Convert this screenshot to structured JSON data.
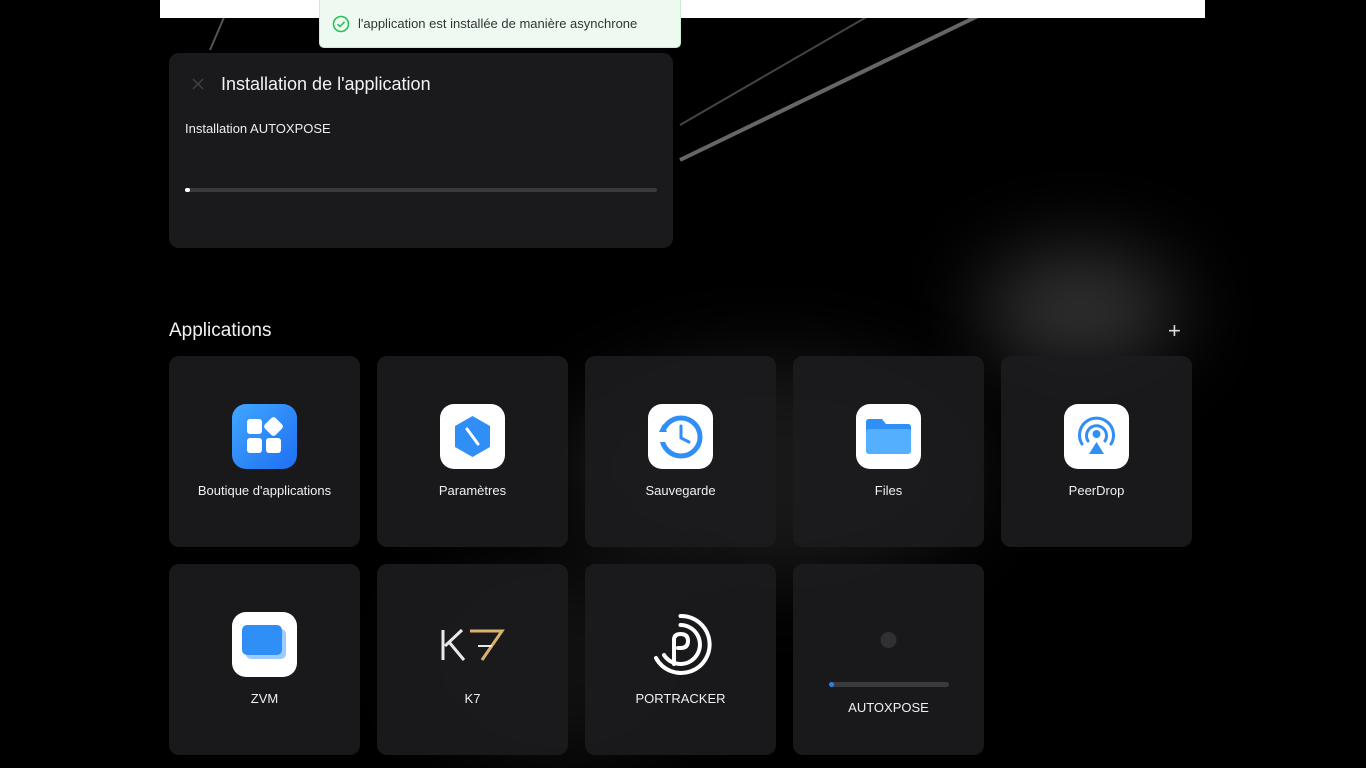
{
  "toast": {
    "message": "l'application est installée de manière asynchrone",
    "icon": "check-circle-icon",
    "color": "#2bbf5a"
  },
  "install_panel": {
    "title": "Installation de l'application",
    "subtitle": "Installation AUTOXPOSE",
    "progress": 0.01
  },
  "section": {
    "title": "Applications",
    "add_label": "+"
  },
  "apps": [
    {
      "label": "Boutique d'applications",
      "icon": "app-store-icon"
    },
    {
      "label": "Paramètres",
      "icon": "settings-icon"
    },
    {
      "label": "Sauvegarde",
      "icon": "backup-icon"
    },
    {
      "label": "Files",
      "icon": "folder-icon"
    },
    {
      "label": "PeerDrop",
      "icon": "peerdrop-icon"
    },
    {
      "label": "ZVM",
      "icon": "zvm-icon"
    },
    {
      "label": "K7",
      "icon": "k7-logo-icon"
    },
    {
      "label": "PORTRACKER",
      "icon": "portracker-icon"
    },
    {
      "label": "AUTOXPOSE",
      "icon": "installing-icon",
      "progress": 0.02
    }
  ],
  "colors": {
    "accent": "#2f7bf6",
    "card_bg": "#1c1c1e"
  }
}
